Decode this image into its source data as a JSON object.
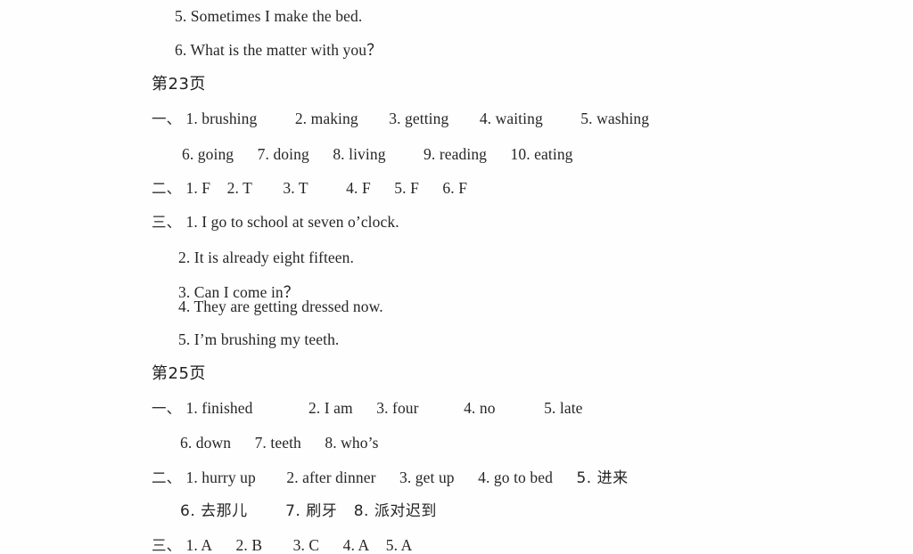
{
  "document": {
    "type": "answer-key",
    "background_color": "#fefefe",
    "text_color": "#262626"
  },
  "top_continued": {
    "items": [
      "5. Sometimes I make the bed.",
      "6. What is the matter with you？"
    ]
  },
  "sections": [
    {
      "page_label_prefix": "第",
      "page_number": "23",
      "page_label_suffix": "页",
      "page_label_full": "第23页",
      "groups": [
        {
          "marker": "一、",
          "lines": [
            {
              "indent": "marker",
              "answers": [
                "1. brushing",
                "2. making",
                "3. getting",
                "4. waiting",
                "5. washing"
              ]
            },
            {
              "indent": "body",
              "answers": [
                "6. going",
                "7. doing",
                "8. living",
                "9. reading",
                "10. eating"
              ]
            }
          ]
        },
        {
          "marker": "二、",
          "lines": [
            {
              "indent": "marker",
              "answers": [
                "1. F",
                "2. T",
                "3. T",
                "4. F",
                "5. F",
                "6. F"
              ]
            }
          ]
        },
        {
          "marker": "三、",
          "lines": [
            {
              "indent": "marker",
              "answers": [
                "1. I go to school at seven o’clock."
              ]
            },
            {
              "indent": "body",
              "answers": [
                "2. It is already eight fifteen."
              ]
            },
            {
              "indent": "body",
              "answers": [
                "3. Can I come in？"
              ]
            },
            {
              "indent": "body",
              "answers": [
                "4. They are getting dressed now."
              ]
            },
            {
              "indent": "body",
              "answers": [
                "5. I’m brushing my teeth."
              ]
            }
          ]
        }
      ]
    },
    {
      "page_label_prefix": "第",
      "page_number": "25",
      "page_label_suffix": "页",
      "page_label_full": "第25页",
      "groups": [
        {
          "marker": "一、",
          "lines": [
            {
              "indent": "marker",
              "answers": [
                "1. finished",
                "2. I am",
                "3. four",
                "4. no",
                "5. late"
              ]
            },
            {
              "indent": "body",
              "answers": [
                "6. down",
                "7. teeth",
                "8. who’s"
              ]
            }
          ]
        },
        {
          "marker": "二、",
          "lines": [
            {
              "indent": "marker",
              "answers": [
                "1. hurry up",
                "2. after dinner",
                "3. get up",
                "4. go to bed",
                "5. 进来"
              ]
            },
            {
              "indent": "body",
              "answers": [
                "6. 去那儿",
                "7. 刷牙",
                "8. 派对迟到"
              ]
            }
          ]
        },
        {
          "marker": "三、",
          "lines": [
            {
              "indent": "marker",
              "answers": [
                "1. A",
                "2. B",
                "3. C",
                "4. A",
                "5. A"
              ]
            }
          ]
        }
      ]
    }
  ]
}
